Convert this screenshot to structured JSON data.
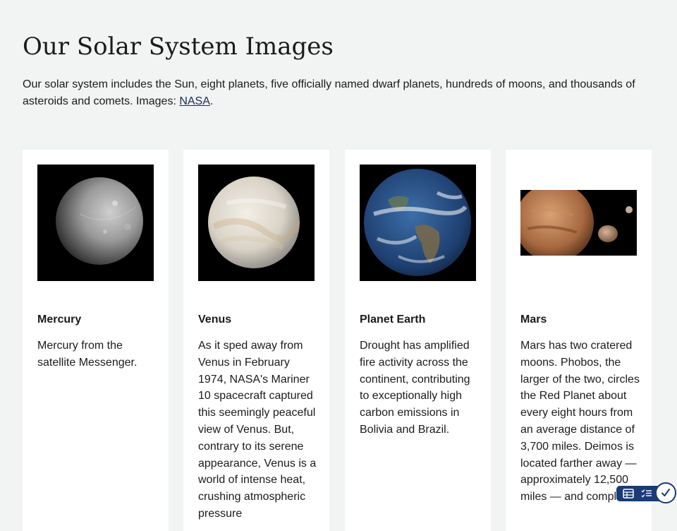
{
  "page": {
    "title": "Our Solar System Images",
    "intro": "Our solar system includes the Sun, eight planets, five officially named dwarf planets, hundreds of moons, and thousands of asteroids and comets. Images: ",
    "intro_link": "NASA",
    "intro_end": "."
  },
  "cards": [
    {
      "title": "Mercury",
      "text": "Mercury from the satellite Messenger."
    },
    {
      "title": "Venus",
      "text": "As it sped away from Venus in February 1974, NASA's Mariner 10 spacecraft captured this seemingly peaceful view of Venus. But, contrary to its serene appearance, Venus is a world of intense heat, crushing atmospheric pressure"
    },
    {
      "title": "Planet Earth",
      "text": "Drought has amplified fire activity across the continent, contributing to exceptionally high carbon emissions in Bolivia and Brazil."
    },
    {
      "title": "Mars",
      "text": "Mars has two cratered moons. Phobos, the larger of the two, circles the Red Planet about every eight hours from an average distance of 3,700 miles. Deimos is located farther away — approximately 12,500 miles — and completes"
    }
  ],
  "toolbar": {
    "icons": [
      "table-icon",
      "checklist-icon",
      "checkmark-icon"
    ],
    "accent": "#1a3a78"
  }
}
